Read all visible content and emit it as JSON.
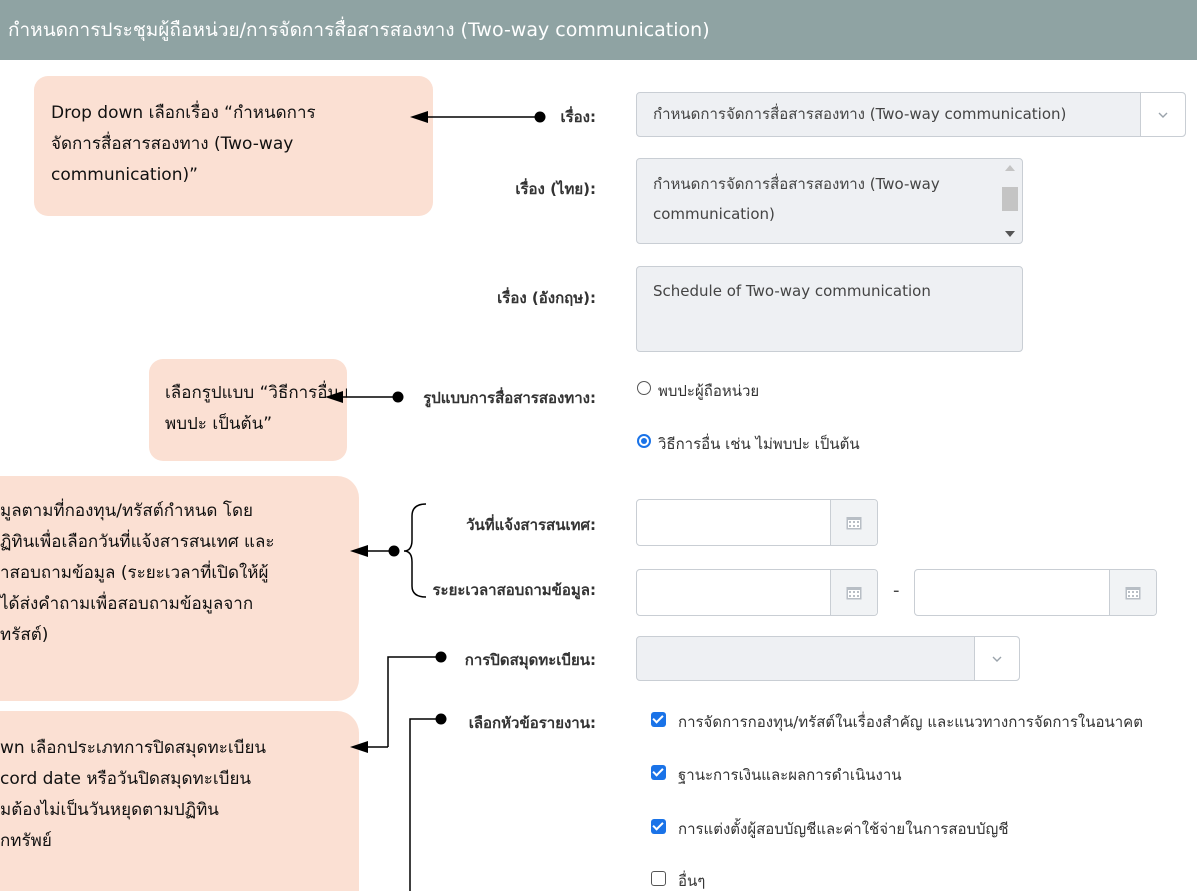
{
  "header": {
    "title": "กำหนดการประชุมผู้ถือหน่วย/การจัดการสื่อสารสองทาง (Two-way communication)"
  },
  "form": {
    "subject_label": "เรื่อง:",
    "subject_value": "กำหนดการจัดการสื่อสารสองทาง (Two-way communication)",
    "subject_th_label": "เรื่อง (ไทย):",
    "subject_th_value": "กำหนดการจัดการสื่อสารสองทาง (Two-way communication)",
    "subject_en_label": "เรื่อง (อังกฤษ):",
    "subject_en_value": "Schedule of Two-way communication",
    "format_label": "รูปแบบการสื่อสารสองทาง:",
    "format_options": [
      "พบปะผู้ถือหน่วย",
      "วิธีการอื่น เช่น ไม่พบปะ เป็นต้น"
    ],
    "format_selected": 1,
    "notify_date_label": "วันที่แจ้งสารสนเทศ:",
    "inquiry_period_label": "ระยะเวลาสอบถามข้อมูล:",
    "range_separator": "-",
    "book_close_label": "การปิดสมุดทะเบียน:",
    "book_close_value": "",
    "report_topics_label": "เลือกหัวข้อรายงาน:",
    "report_topics": [
      {
        "label": "การจัดการกองทุน/ทรัสต์ในเรื่องสำคัญ และแนวทางการจัดการในอนาคต",
        "checked": true
      },
      {
        "label": "ฐานะการเงินและผลการดำเนินงาน",
        "checked": true
      },
      {
        "label": "การแต่งตั้งผู้สอบบัญชีและค่าใช้จ่ายในการสอบบัญชี",
        "checked": true
      },
      {
        "label": "อื่นๆ",
        "checked": false
      }
    ]
  },
  "annotations": {
    "subject_note": [
      "Drop down เลือกเรื่อง “กำหนดการ",
      "จัดการสื่อสารสองทาง (Two-way",
      "communication)”"
    ],
    "format_note": [
      "เลือกรูปแบบ “วิธีการอื่น เช่น ไม่",
      "พบปะ เป็นต้น”"
    ],
    "date_note": [
      "มูลตามที่กองทุน/ทรัสต์กำหนด โดย",
      "ฏิทินเพื่อเลือกวันที่แจ้งสารสนเทศ และ",
      "าสอบถามข้อมูล (ระยะเวลาที่เปิดให้ผู้",
      "ได้ส่งคำถามเพื่อสอบถามข้อมูลจาก",
      "ทรัสต์)"
    ],
    "book_note": [
      "wn เลือกประเภทการปิดสมุดทะเบียน",
      "cord date หรือวันปิดสมุดทะเบียน",
      "มต้องไม่เป็นวันหยุดตามปฏิทิน",
      "กทรัพย์"
    ]
  },
  "colors": {
    "header_bg": "#8fa3a3",
    "bubble_bg": "#fbe0d3",
    "accent": "#1a73e8"
  },
  "icons": [
    "chevron-down-icon",
    "calendar-icon",
    "radio-icon",
    "checkbox-icon",
    "arrow-left-icon"
  ]
}
